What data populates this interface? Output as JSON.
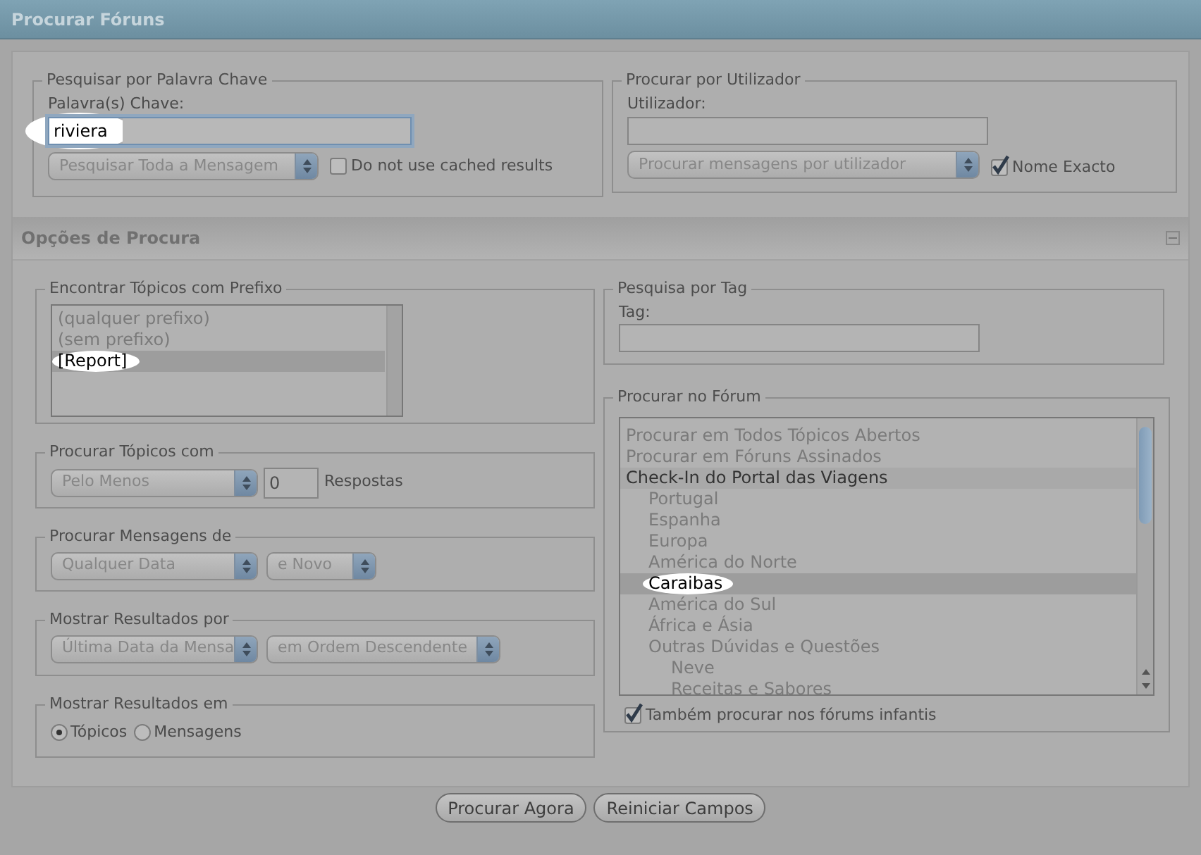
{
  "header": {
    "title": "Procurar Fóruns"
  },
  "keyword_search": {
    "legend": "Pesquisar por Palavra Chave",
    "label": "Palavra(s) Chave:",
    "value": "riviera",
    "spotlight": true,
    "scope_select": "Pesquisar Toda a Mensagem",
    "no_cache": {
      "label": "Do not use cached results",
      "checked": false
    }
  },
  "user_search": {
    "legend": "Procurar por Utilizador",
    "label": "Utilizador:",
    "mode_select": "Procurar mensagens por utilizador",
    "exact": {
      "label": "Nome Exacto",
      "checked": true
    }
  },
  "options": {
    "title": "Opções de Procura",
    "expanded": true
  },
  "prefix": {
    "legend": "Encontrar Tópicos com Prefixo",
    "items": [
      {
        "label": "(qualquer prefixo)",
        "selected": false,
        "spotlight": false
      },
      {
        "label": "(sem prefixo)",
        "selected": false,
        "spotlight": false
      },
      {
        "label": "[Report]",
        "selected": true,
        "spotlight": true
      }
    ]
  },
  "topics_with": {
    "legend": "Procurar Tópicos com",
    "select": "Pelo Menos",
    "count": "0",
    "suffix": "Respostas"
  },
  "messages_from": {
    "legend": "Procurar Mensagens de",
    "date_select": "Qualquer Data",
    "range_select": "e Novo"
  },
  "sort_by": {
    "legend": "Mostrar Resultados por",
    "field_select": "Última Data da Mensa",
    "order_select": "em Ordem Descendente"
  },
  "show_as": {
    "legend": "Mostrar Resultados em",
    "options": [
      {
        "label": "Tópicos",
        "selected": true
      },
      {
        "label": "Mensagens",
        "selected": false
      }
    ]
  },
  "tag_search": {
    "legend": "Pesquisa por Tag",
    "label": "Tag:"
  },
  "forum": {
    "legend": "Procurar no Fórum",
    "items": [
      {
        "label": "Procurar em Todos Tópicos Abertos",
        "kind": "option",
        "selected": false,
        "spotlight": false
      },
      {
        "label": "Procurar em Fóruns Assinados",
        "kind": "option",
        "selected": false,
        "spotlight": false
      },
      {
        "label": "Check-In do Portal das Viagens",
        "kind": "category",
        "selected": false,
        "spotlight": false,
        "children": [
          {
            "label": "Portugal",
            "kind": "option",
            "selected": false,
            "spotlight": false
          },
          {
            "label": "Espanha",
            "kind": "option",
            "selected": false,
            "spotlight": false
          },
          {
            "label": "Europa",
            "kind": "option",
            "selected": false,
            "spotlight": false
          },
          {
            "label": "América do Norte",
            "kind": "option",
            "selected": false,
            "spotlight": false
          },
          {
            "label": "Caraibas",
            "kind": "option",
            "selected": true,
            "spotlight": true
          },
          {
            "label": "América do Sul",
            "kind": "option",
            "selected": false,
            "spotlight": false
          },
          {
            "label": "África e Ásia",
            "kind": "option",
            "selected": false,
            "spotlight": false
          },
          {
            "label": "Outras Dúvidas e Questões",
            "kind": "option",
            "selected": false,
            "spotlight": false,
            "children": [
              {
                "label": "Neve",
                "kind": "option",
                "selected": false,
                "spotlight": false
              },
              {
                "label": "Receitas e Sabores",
                "kind": "option",
                "selected": false,
                "spotlight": false
              }
            ]
          }
        ]
      }
    ],
    "include_children": {
      "label": "Também procurar nos fórums infantis",
      "checked": true
    }
  },
  "buttons": [
    {
      "label": "Procurar Agora"
    },
    {
      "label": "Reiniciar Campos"
    }
  ]
}
